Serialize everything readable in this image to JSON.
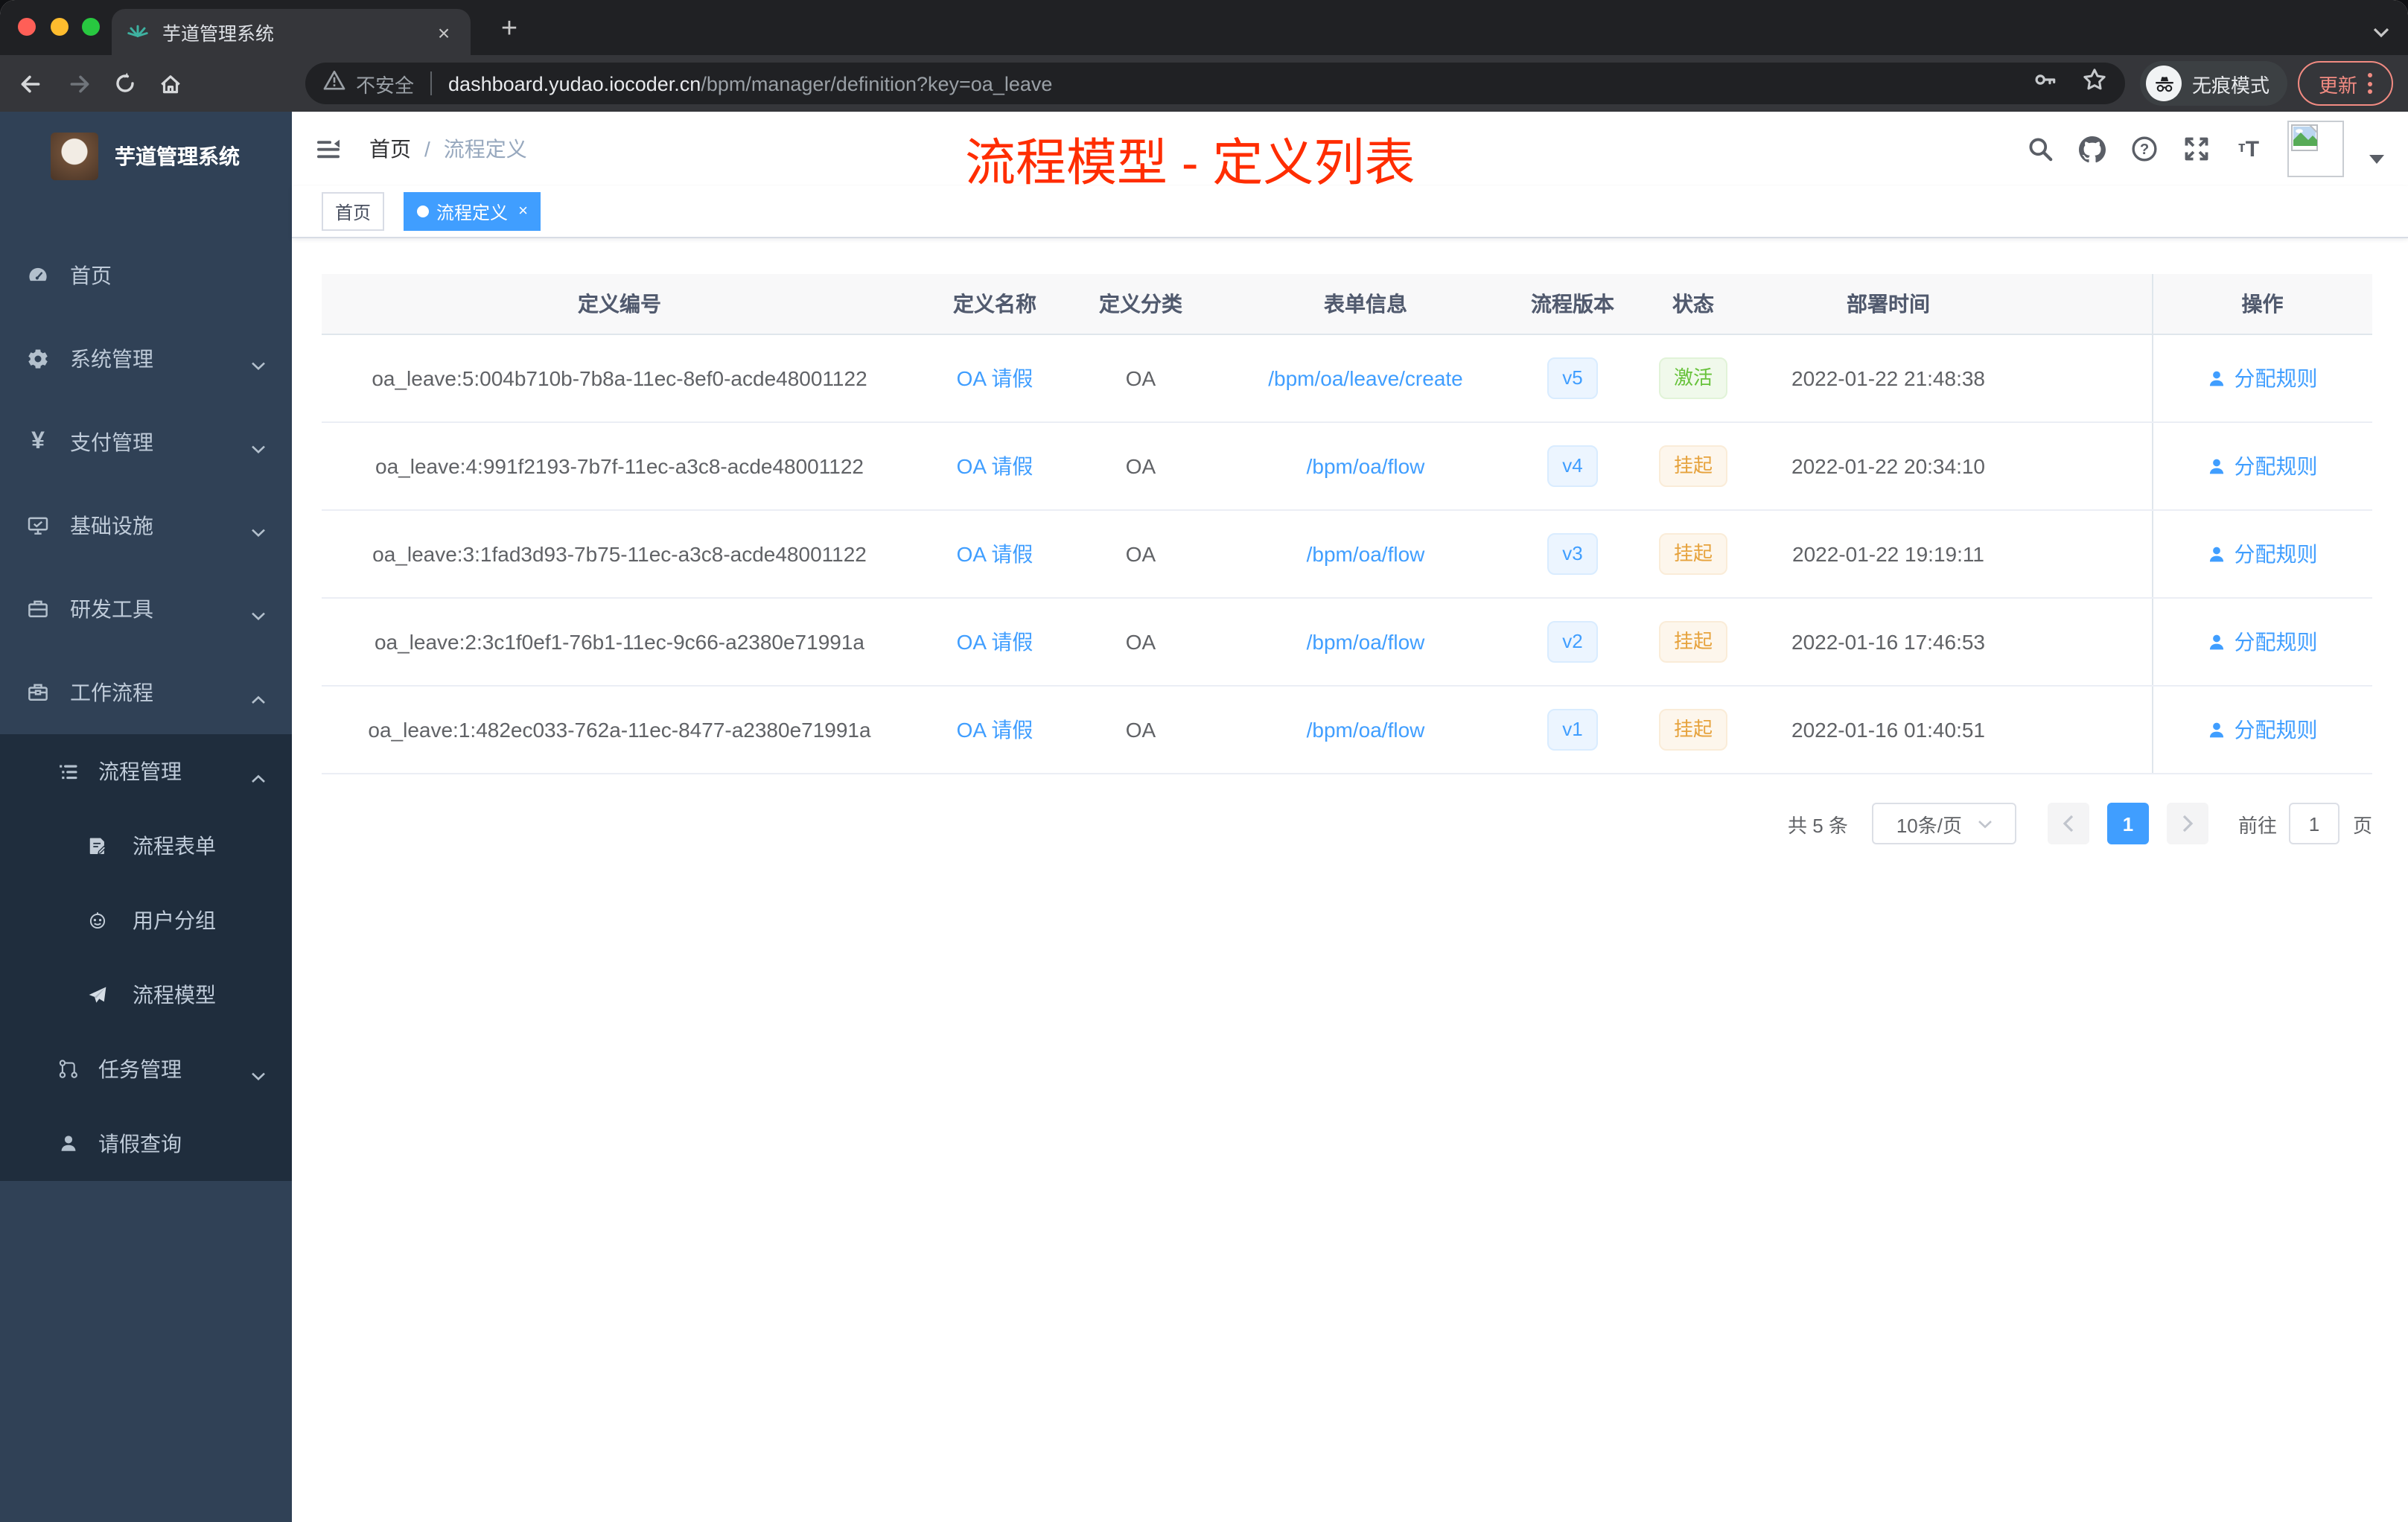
{
  "browser": {
    "tab_title": "芋道管理系统",
    "tab_close": "×",
    "new_tab": "+",
    "security_label": "不安全",
    "url_host": "dashboard.yudao.iocoder.cn",
    "url_path": "/bpm/manager/definition?key=oa_leave",
    "incognito_label": "无痕模式",
    "update_label": "更新"
  },
  "sidebar": {
    "app_title": "芋道管理系统",
    "items": [
      {
        "label": "首页"
      },
      {
        "label": "系统管理"
      },
      {
        "label": "支付管理"
      },
      {
        "label": "基础设施"
      },
      {
        "label": "研发工具"
      },
      {
        "label": "工作流程"
      },
      {
        "label": "流程管理"
      },
      {
        "label": "流程表单"
      },
      {
        "label": "用户分组"
      },
      {
        "label": "流程模型"
      },
      {
        "label": "任务管理"
      },
      {
        "label": "请假查询"
      }
    ]
  },
  "navbar": {
    "breadcrumb_home": "首页",
    "breadcrumb_separator": "/",
    "breadcrumb_current": "流程定义",
    "annotation": "流程模型 - 定义列表"
  },
  "tags": {
    "home": "首页",
    "active": "流程定义",
    "active_close": "×"
  },
  "table": {
    "headers": [
      "定义编号",
      "定义名称",
      "定义分类",
      "表单信息",
      "流程版本",
      "状态",
      "部署时间",
      "操作"
    ],
    "action_label": "分配规则",
    "rows": [
      {
        "id": "oa_leave:5:004b710b-7b8a-11ec-8ef0-acde48001122",
        "name": "OA 请假",
        "category": "OA",
        "form": "/bpm/oa/leave/create",
        "version": "v5",
        "status": "激活",
        "status_type": "active",
        "time": "2022-01-22 21:48:38"
      },
      {
        "id": "oa_leave:4:991f2193-7b7f-11ec-a3c8-acde48001122",
        "name": "OA 请假",
        "category": "OA",
        "form": "/bpm/oa/flow",
        "version": "v4",
        "status": "挂起",
        "status_type": "suspended",
        "time": "2022-01-22 20:34:10"
      },
      {
        "id": "oa_leave:3:1fad3d93-7b75-11ec-a3c8-acde48001122",
        "name": "OA 请假",
        "category": "OA",
        "form": "/bpm/oa/flow",
        "version": "v3",
        "status": "挂起",
        "status_type": "suspended",
        "time": "2022-01-22 19:19:11"
      },
      {
        "id": "oa_leave:2:3c1f0ef1-76b1-11ec-9c66-a2380e71991a",
        "name": "OA 请假",
        "category": "OA",
        "form": "/bpm/oa/flow",
        "version": "v2",
        "status": "挂起",
        "status_type": "suspended",
        "time": "2022-01-16 17:46:53"
      },
      {
        "id": "oa_leave:1:482ec033-762a-11ec-8477-a2380e71991a",
        "name": "OA 请假",
        "category": "OA",
        "form": "/bpm/oa/flow",
        "version": "v1",
        "status": "挂起",
        "status_type": "suspended",
        "time": "2022-01-16 01:40:51"
      }
    ]
  },
  "pagination": {
    "total": "共 5 条",
    "page_size": "10条/页",
    "current_page": "1",
    "goto_label": "前往",
    "goto_value": "1",
    "page_unit": "页"
  },
  "colors": {
    "accent_blue": "#409eff",
    "annotation_red": "#ff2d00",
    "status_active_green": "#67c23a",
    "status_suspended_orange": "#e6a23c",
    "sidebar_bg": "#304156",
    "sidebar_submenu_bg": "#1f2d3d"
  }
}
